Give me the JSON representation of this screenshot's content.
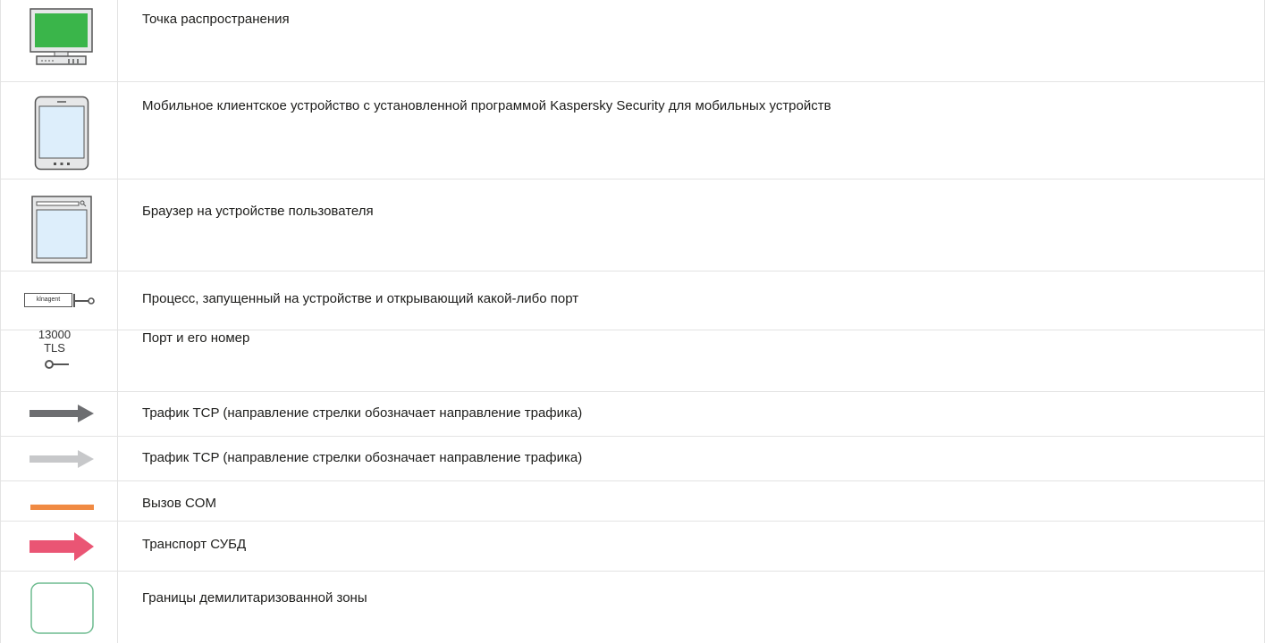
{
  "legend": {
    "rows": [
      {
        "icon": "distribution-point-monitor-icon",
        "text": "Точка распространения"
      },
      {
        "icon": "mobile-device-icon",
        "text": "Мобильное клиентское устройство с установленной программой Kaspersky Security для мобильных устройств"
      },
      {
        "icon": "browser-window-icon",
        "text": "Браузер на устройстве пользователя"
      },
      {
        "icon": "process-port-icon",
        "text": "Процесс, запущенный на устройстве и открывающий какой-либо порт",
        "process_label": "klnagent"
      },
      {
        "icon": "port-icon",
        "text": "Порт и его номер",
        "port_number": "13000",
        "port_protocol": "TLS"
      },
      {
        "icon": "tcp-arrow-dark-icon",
        "text": "Трафик TCP (направление стрелки обозначает направление трафика)",
        "color": "#6d6e71"
      },
      {
        "icon": "tcp-arrow-light-icon",
        "text": "Трафик TCP (направление стрелки обозначает направление трафика)",
        "color": "#c7c8ca"
      },
      {
        "icon": "com-call-line-icon",
        "text": "Вызов COM",
        "color": "#f08a43"
      },
      {
        "icon": "dbms-arrow-icon",
        "text": "Транспорт СУБД",
        "color": "#ea5574"
      },
      {
        "icon": "dmz-boundary-icon",
        "text": "Границы демилитаризованной зоны",
        "color": "#6dbb8f"
      }
    ]
  }
}
